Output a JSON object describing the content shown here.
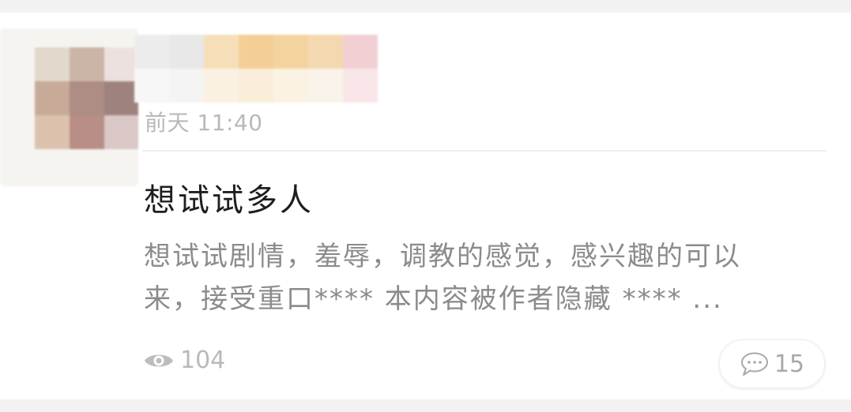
{
  "post": {
    "time": "前天 11:40",
    "title": "想试试多人",
    "excerpt_line1": "想试试剧情，羞辱，调教的感觉，感兴趣的可以",
    "excerpt_line2": "来，接受重口**** 本内容被作者隐藏 **** ...",
    "views": "104",
    "comments": "15"
  },
  "icons": {
    "views": "eye-icon",
    "comments": "comment-bubble-icon"
  },
  "colors": {
    "background": "#f2f2f2",
    "card": "#ffffff",
    "title": "#1e1e1e",
    "body_text": "#8b8b8b",
    "meta_text": "#b9b9b9"
  }
}
